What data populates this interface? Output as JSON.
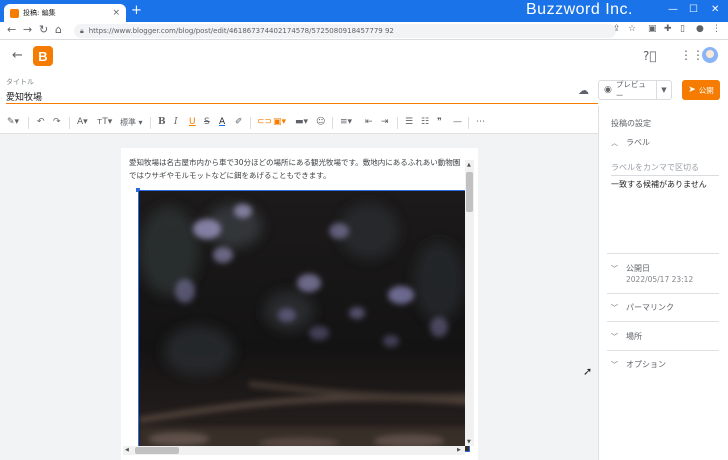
{
  "browser": {
    "tab_title": "投稿: 編集",
    "tab_close": "×",
    "new_tab": "+",
    "url": "https://www.blogger.com/blog/post/edit/461867374402174578/5725080918457779 92",
    "brand_label": "Buzzword Inc.",
    "window_controls": [
      "—",
      "☐",
      "✕"
    ]
  },
  "app": {
    "title_caption": "タイトル",
    "title_value": "愛知牧場",
    "preview_label": "プレビュー",
    "publish_label": "公開"
  },
  "format_bar": {
    "style_label": "標準"
  },
  "document": {
    "body_text": "愛知牧場は名古屋市内から車で30分ほどの場所にある観光牧場です。敷地内にあるふれあい動物園ではウサギやモルモットなどに餌をあげることもできます。"
  },
  "sidebar": {
    "heading": "投稿の設定",
    "labels_section": "ラベル",
    "labels_placeholder": "ラベルをカンマで区切る",
    "labels_no_match": "一致する候補がありません",
    "published_section": "公開日",
    "published_value": "2022/05/17 23:12",
    "permalink_section": "パーマリンク",
    "location_section": "場所",
    "options_section": "オプション"
  },
  "icons": {
    "blogger_logo": "blogger-logo",
    "accent_color": "#f57c00",
    "browser_chrome_color": "#1a73e8"
  }
}
